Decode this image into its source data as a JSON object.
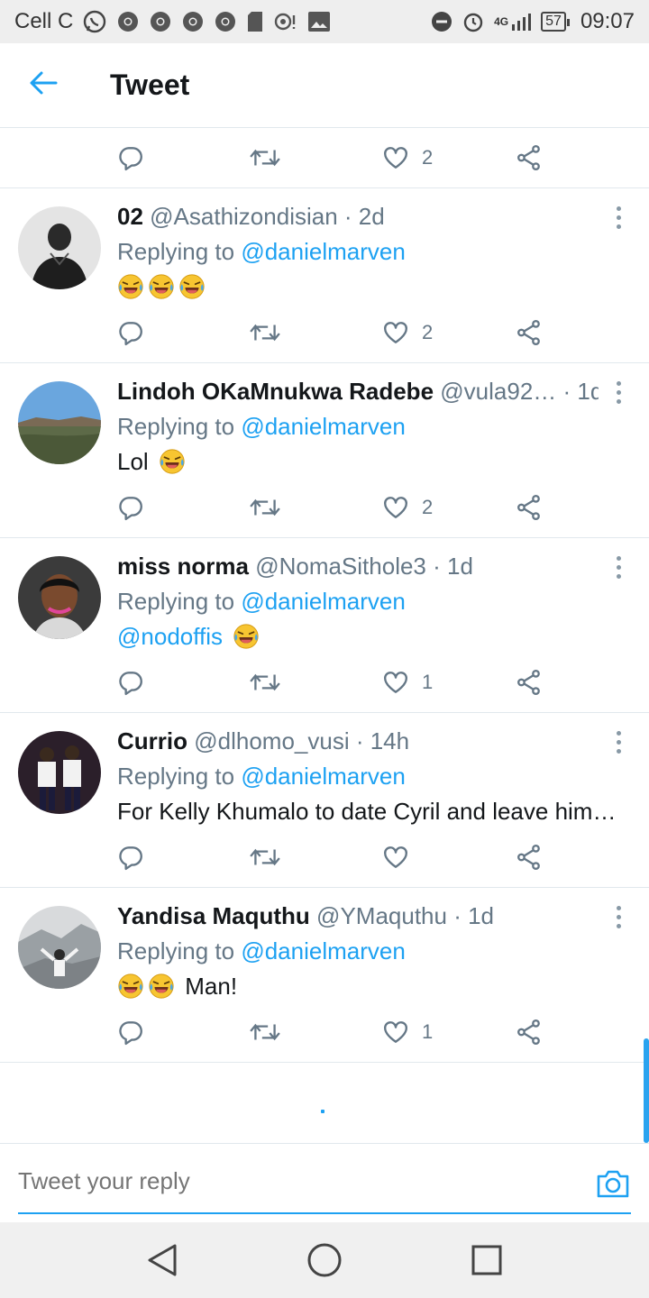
{
  "status_bar": {
    "carrier": "Cell C",
    "network": "4G",
    "battery": "57",
    "time": "09:07"
  },
  "header": {
    "title": "Tweet"
  },
  "top_actions": {
    "like_count": "2"
  },
  "tweets": [
    {
      "name": "02",
      "handle": "@Asathizondisian",
      "time": "· 2d",
      "replying_label": "Replying to",
      "replying_to": "@danielmarven",
      "text": "",
      "like_count": "2"
    },
    {
      "name": "Lindoh OKaMnukwa Radebe",
      "handle": "@vula92…",
      "time": "· 1d",
      "replying_label": "Replying to",
      "replying_to": "@danielmarven",
      "text": "Lol",
      "like_count": "2"
    },
    {
      "name": "miss norma",
      "handle": "@NomaSithole3",
      "time": "· 1d",
      "replying_label": "Replying to",
      "replying_to": "@danielmarven",
      "mention": "@nodoffis",
      "like_count": "1"
    },
    {
      "name": "Currio",
      "handle": "@dlhomo_vusi",
      "time": "· 14h",
      "replying_label": "Replying to",
      "replying_to": "@danielmarven",
      "text": "For Kelly Khumalo to date Cyril and leave him…",
      "like_count": ""
    },
    {
      "name": "Yandisa Maquthu",
      "handle": "@YMaquthu",
      "time": "· 1d",
      "replying_label": "Replying to",
      "replying_to": "@danielmarven",
      "text": "Man!",
      "like_count": "1"
    }
  ],
  "composer": {
    "placeholder": "Tweet your reply"
  },
  "colors": {
    "accent": "#1da1f2",
    "muted": "#657786",
    "divider": "#e1e8ed"
  }
}
